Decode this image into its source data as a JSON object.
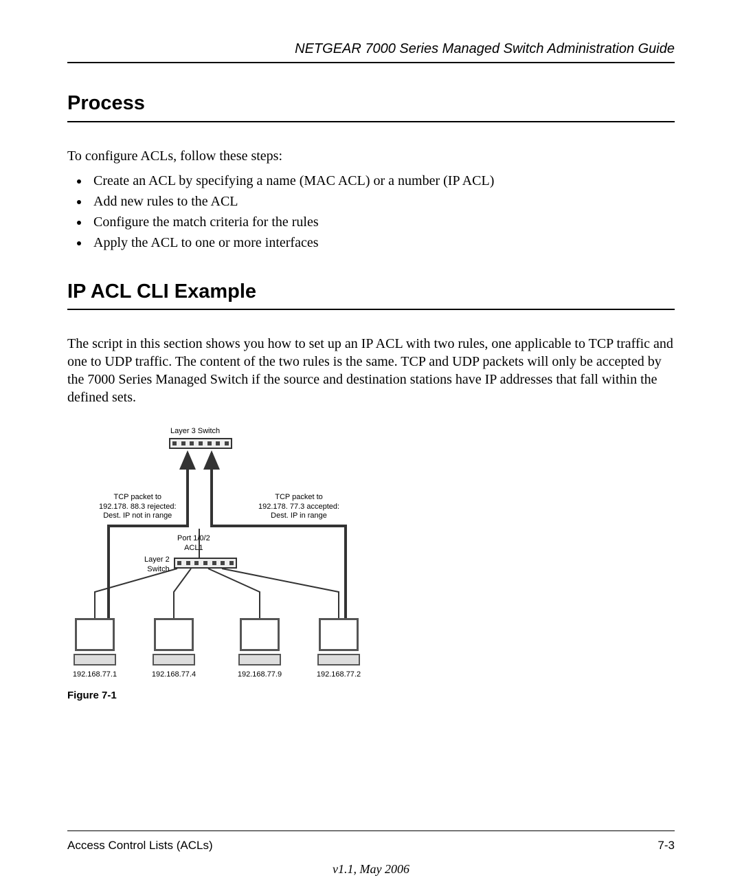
{
  "header": {
    "doc_title": "NETGEAR 7000  Series Managed Switch Administration Guide"
  },
  "section1": {
    "heading": "Process",
    "intro": "To configure ACLs, follow these steps:",
    "bullets": [
      "Create an ACL by specifying a name (MAC ACL) or a number (IP ACL)",
      "Add new rules to the ACL",
      "Configure the match criteria for the rules",
      "Apply the ACL to one or more interfaces"
    ]
  },
  "section2": {
    "heading": "IP ACL CLI Example",
    "body": "The script in this section shows you how to set up an IP ACL with two rules, one applicable to TCP traffic and one to UDP traffic. The content of the two rules is the same. TCP and UDP packets will only be accepted by the 7000 Series Managed Switch if the source and destination stations have IP addresses that fall within the defined sets."
  },
  "figure": {
    "layer3_label": "Layer 3 Switch",
    "left_note_l1": "TCP packet to",
    "left_note_l2": "192.178. 88.3 rejected:",
    "left_note_l3": "Dest. IP not in range",
    "right_note_l1": "TCP packet to",
    "right_note_l2": "192.178. 77.3 accepted:",
    "right_note_l3": "Dest. IP in range",
    "port_label_l1": "Port 1/0/2",
    "port_label_l2": "ACL1",
    "layer2_label_l1": "Layer 2",
    "layer2_label_l2": "Switch",
    "pc1_ip": "192.168.77.1",
    "pc2_ip": "192.168.77.4",
    "pc3_ip": "192.168.77.9",
    "pc4_ip": "192.168.77.2",
    "caption": "Figure 7-1"
  },
  "footer": {
    "left": "Access Control Lists (ACLs)",
    "right": "7-3",
    "version": "v1.1, May 2006"
  }
}
